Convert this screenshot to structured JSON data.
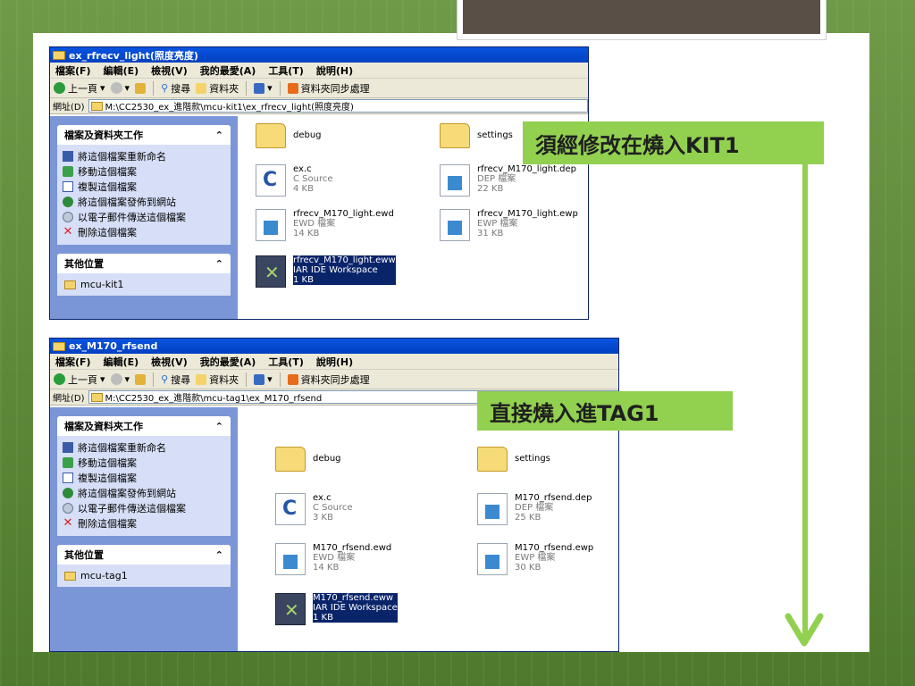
{
  "window1": {
    "title": "ex_rfrecv_light(照度亮度)",
    "menu": [
      "檔案(F)",
      "編輯(E)",
      "檢視(V)",
      "我的最愛(A)",
      "工具(T)",
      "說明(H)"
    ],
    "toolbar": {
      "back": "上一頁",
      "search": "搜尋",
      "folders": "資料夾",
      "sync": "資料夾同步處理"
    },
    "address_label": "網址(D)",
    "address": "M:\\CC2530_ex_進階款\\mcu-kit1\\ex_rfrecv_light(照度亮度)",
    "tasks_header": "檔案及資料夾工作",
    "tasks": [
      "將這個檔案重新命名",
      "移動這個檔案",
      "複製這個檔案",
      "將這個檔案發佈到網站",
      "以電子郵件傳送這個檔案",
      "刪除這個檔案"
    ],
    "other_header": "其他位置",
    "other_item": "mcu-kit1",
    "files": {
      "debug": {
        "name": "debug"
      },
      "settings": {
        "name": "settings"
      },
      "exc": {
        "name": "ex.c",
        "type": "C Source",
        "size": "4 KB"
      },
      "dep": {
        "name": "rfrecv_M170_light.dep",
        "type": "DEP 檔案",
        "size": "22 KB"
      },
      "ewd": {
        "name": "rfrecv_M170_light.ewd",
        "type": "EWD 檔案",
        "size": "14 KB"
      },
      "ewp": {
        "name": "rfrecv_M170_light.ewp",
        "type": "EWP 檔案",
        "size": "31 KB"
      },
      "eww": {
        "name": "rfrecv_M170_light.eww",
        "type": "IAR IDE Workspace",
        "size": "1 KB"
      }
    }
  },
  "window2": {
    "title": "ex_M170_rfsend",
    "menu": [
      "檔案(F)",
      "編輯(E)",
      "檢視(V)",
      "我的最愛(A)",
      "工具(T)",
      "說明(H)"
    ],
    "toolbar": {
      "back": "上一頁",
      "search": "搜尋",
      "folders": "資料夾",
      "sync": "資料夾同步處理"
    },
    "address_label": "網址(D)",
    "address": "M:\\CC2530_ex_進階款\\mcu-tag1\\ex_M170_rfsend",
    "tasks_header": "檔案及資料夾工作",
    "tasks": [
      "將這個檔案重新命名",
      "移動這個檔案",
      "複製這個檔案",
      "將這個檔案發佈到網站",
      "以電子郵件傳送這個檔案",
      "刪除這個檔案"
    ],
    "other_header": "其他位置",
    "other_item": "mcu-tag1",
    "files": {
      "debug": {
        "name": "debug"
      },
      "settings": {
        "name": "settings"
      },
      "exc": {
        "name": "ex.c",
        "type": "C Source",
        "size": "3 KB"
      },
      "dep": {
        "name": "M170_rfsend.dep",
        "type": "DEP 檔案",
        "size": "25 KB"
      },
      "ewd": {
        "name": "M170_rfsend.ewd",
        "type": "EWD 檔案",
        "size": "14 KB"
      },
      "ewp": {
        "name": "M170_rfsend.ewp",
        "type": "EWP 檔案",
        "size": "30 KB"
      },
      "eww": {
        "name": "M170_rfsend.eww",
        "type": "IAR IDE Workspace",
        "size": "1 KB"
      }
    }
  },
  "callouts": {
    "first": "須經修改在燒入KIT1",
    "second": "直接燒入進TAG1"
  },
  "colors": {
    "accent_green": "#92d050",
    "xp_blue": "#0a54e0"
  }
}
